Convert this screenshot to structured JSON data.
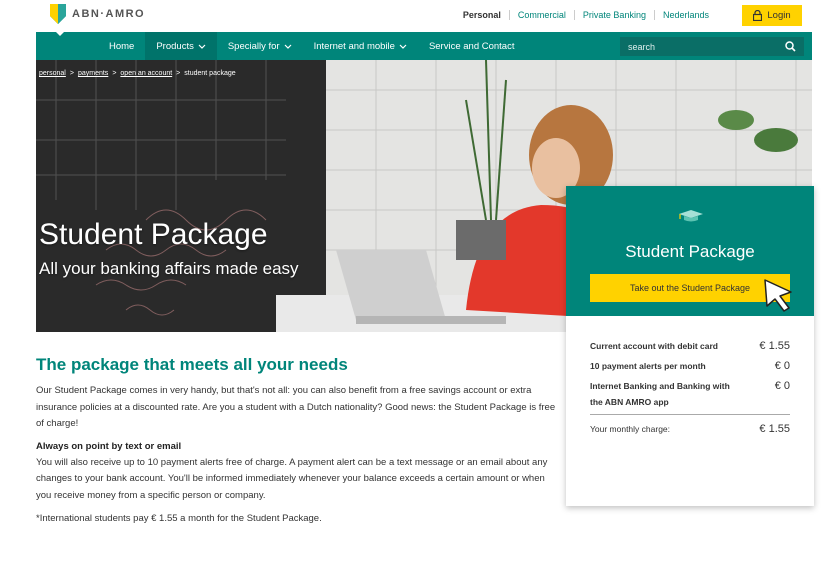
{
  "brand": {
    "name": "ABN·AMRO"
  },
  "top_links": [
    "Personal",
    "Commercial",
    "Private Banking",
    "Nederlands"
  ],
  "login": {
    "label": "Login"
  },
  "nav": {
    "items": [
      {
        "label": "Home",
        "caret": false
      },
      {
        "label": "Products",
        "caret": true
      },
      {
        "label": "Specially for",
        "caret": true
      },
      {
        "label": "Internet and mobile",
        "caret": true
      },
      {
        "label": "Service and Contact",
        "caret": false
      }
    ],
    "search_placeholder": "search"
  },
  "breadcrumb": [
    "personal",
    "payments",
    "open an account",
    "student package"
  ],
  "hero": {
    "title": "Student Package",
    "subtitle": "All your banking affairs made easy"
  },
  "card": {
    "title": "Student Package",
    "button_label": "Take out the Student Package",
    "rows": [
      {
        "label": "Current account with debit card",
        "value": "€ 1.55",
        "bold": true
      },
      {
        "label": "10 payment alerts per month",
        "value": "€ 0",
        "bold": true
      },
      {
        "label": "Internet Banking and Banking with the ABN AMRO app",
        "value": "€ 0",
        "bold": true
      }
    ],
    "monthly_label": "Your monthly charge:",
    "monthly_value": "€ 1.55"
  },
  "content": {
    "heading": "The package that meets all your needs",
    "intro": "Our Student Package comes in very handy, but that's not all: you can also benefit from a free savings account or extra insurance policies at a discounted rate. Are you a student with a Dutch nationality? Good news: the Student Package is free of charge!",
    "subheading": "Always on point by text or email",
    "body": "You will also receive up to 10 payment alerts free of charge. A payment alert can be a text message or an email about any changes to your bank account. You'll be informed immediately whenever your balance exceeds a certain amount or when you receive money from a specific person or company.",
    "note": "*International students pay € 1.55 a month for the Student Package."
  },
  "colors": {
    "brand_green": "#00857a",
    "accent_yellow": "#ffd200"
  }
}
